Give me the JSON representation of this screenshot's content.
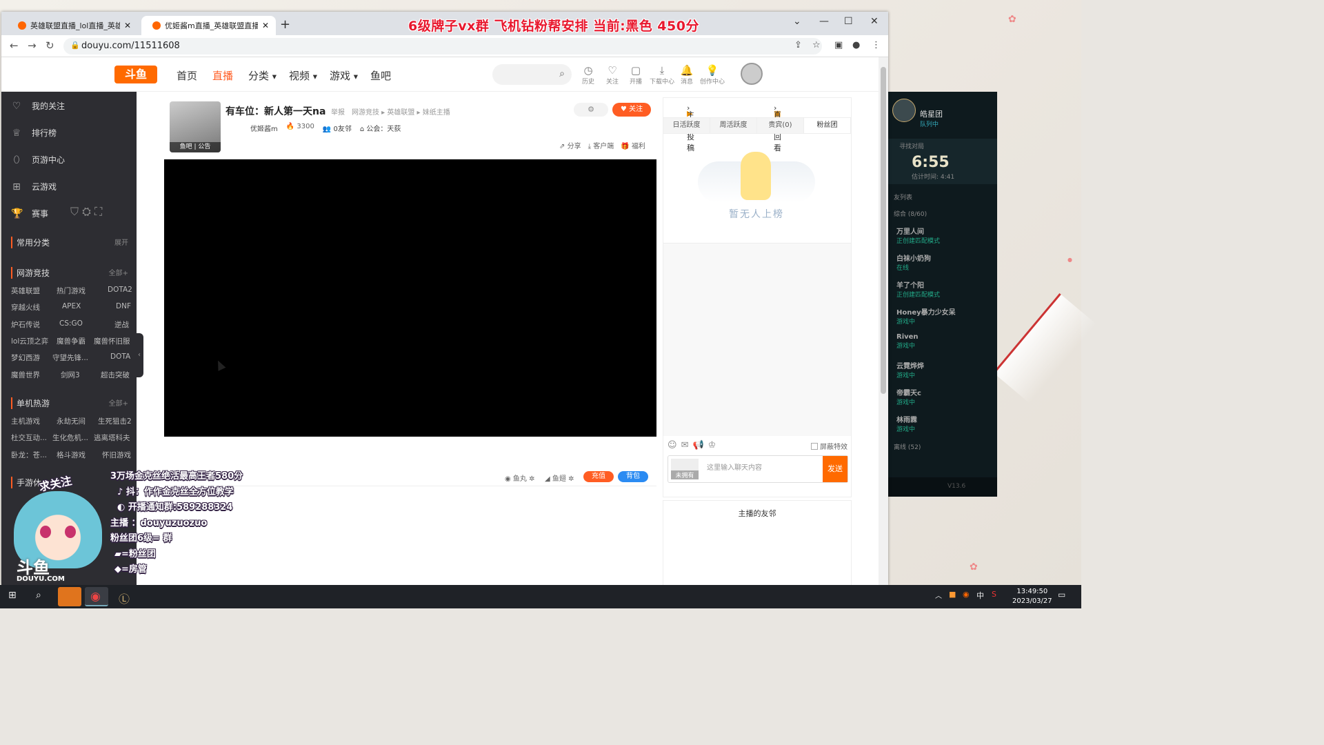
{
  "browser": {
    "tabs": [
      {
        "title": "英雄联盟直播_lol直播_英雄联盟"
      },
      {
        "title": "优姬酱m直播_英雄联盟直播_斗鱼"
      }
    ],
    "url": "douyu.com/11511608",
    "overlay_banner": "6级牌子vx群  飞机钻粉帮安排  当前:黑色 450分"
  },
  "header": {
    "logo": "斗鱼",
    "nav": [
      "首页",
      "直播",
      "分类",
      "视频",
      "游戏",
      "鱼吧"
    ],
    "icons": [
      "历史",
      "关注",
      "开播",
      "下载中心",
      "消息",
      "创作中心"
    ]
  },
  "sidebar": {
    "items": [
      "我的关注",
      "排行榜",
      "页游中心",
      "云游戏",
      "赛事"
    ],
    "common": {
      "title": "常用分类",
      "more": "展开"
    },
    "sections": [
      {
        "title": "网游竞技",
        "more": "全部",
        "cats": [
          "英雄联盟",
          "热门游戏",
          "DOTA2",
          "穿越火线",
          "APEX",
          "DNF",
          "炉石传说",
          "CS:GO",
          "逆战",
          "lol云顶之弈",
          "魔兽争霸",
          "魔兽怀旧服",
          "梦幻西游",
          "守望先锋...",
          "DOTA",
          "魔兽世界",
          "剑网3",
          "超击突破"
        ]
      },
      {
        "title": "单机热游",
        "more": "全部",
        "cats": [
          "主机游戏",
          "永劫无间",
          "生死狙击2",
          "杜交互动...",
          "生化危机...",
          "逃离塔科夫",
          "卧龙：苍...",
          "格斗游戏",
          "怀旧游戏"
        ]
      },
      {
        "title": "手游休",
        "more": "",
        "cats": []
      }
    ]
  },
  "room": {
    "title": "有车位：新人第一天na",
    "report": "举报",
    "breadcrumb": "网游竞技 ▸ 英雄联盟 ▸ 妹纸主播",
    "streamer": "优姬酱m",
    "hot": "3300",
    "friends": "0友邻",
    "guild": "公会：天荻",
    "thumb_label": "鱼吧  |  公告",
    "follow": "关注",
    "actions": [
      "分享",
      "客户端",
      "福利"
    ]
  },
  "gift_bar": {
    "items": [
      "鱼丸",
      "鱼翅"
    ],
    "recharge": "充值",
    "backpack": "背包"
  },
  "right_panel": {
    "top": [
      "主播投稿",
      "直播回看"
    ],
    "tabs": [
      "日活跃度",
      "周活跃度",
      "贵宾(0)",
      "粉丝团"
    ],
    "empty_text": "暂无人上榜",
    "shield": "屏蔽特效",
    "chat_placeholder": "这里输入聊天内容",
    "avatar_label": "未拥有",
    "send": "发送"
  },
  "friends_panel": {
    "title": "主播的友邻"
  },
  "stream_overlay": {
    "follow_tag": "求关注",
    "lines": [
      "3万场金克丝绝活最高王者580分",
      "抖：作作金克丝全方位教学",
      "开播通知群:589288324",
      "主播 ：douyuzuozuo",
      "粉丝团6级= 群",
      "=粉丝团",
      "=房管"
    ],
    "watermark": "斗鱼",
    "watermark_sub": "DOUYU.COM"
  },
  "game_client": {
    "player": "皓星团",
    "status": "队列中",
    "finding": "寻找对局",
    "timer": "6:55",
    "estimate": "估计时间: 4:41",
    "list_label": "友列表",
    "group": "综合 (8/60)",
    "friends": [
      {
        "name": "万里人间",
        "status": "正创建匹配模式"
      },
      {
        "name": "白袜小奶狗",
        "status": "在线"
      },
      {
        "name": "羊了个阳",
        "status": "正创建匹配模式"
      },
      {
        "name": "Honey暴力少女呆",
        "status": "游戏中"
      },
      {
        "name": "Riven",
        "status": "游戏中"
      },
      {
        "name": "云霓烨烨",
        "status": "游戏中"
      },
      {
        "name": "帝霸天c",
        "status": "游戏中"
      },
      {
        "name": "林雨霖",
        "status": "游戏中"
      }
    ],
    "offline": "离线 (52)",
    "version": "V13.6"
  },
  "taskbar": {
    "time": "13:49:50",
    "date": "2023/03/27",
    "ime": "中"
  },
  "colors": {
    "accent": "#ff5d23",
    "sidebar": "#2d2d32"
  }
}
